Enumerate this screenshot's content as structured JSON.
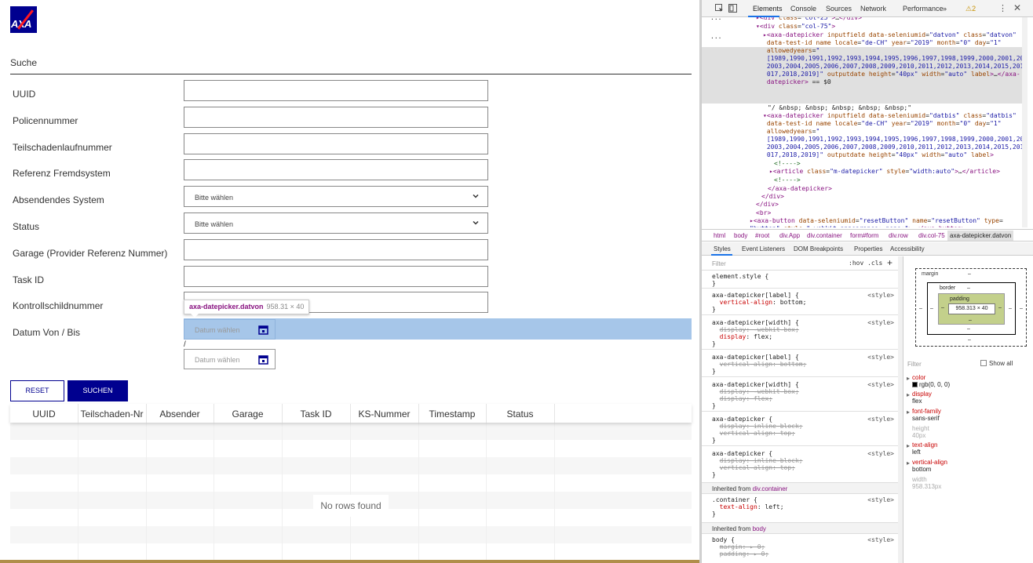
{
  "app": {
    "logo_text": "AXA",
    "section_title": "Suche",
    "fields": [
      {
        "label": "UUID",
        "type": "input",
        "value": ""
      },
      {
        "label": "Policennummer",
        "type": "input",
        "value": ""
      },
      {
        "label": "Teilschadenlaufnummer",
        "type": "input",
        "value": ""
      },
      {
        "label": "Referenz Fremdsystem",
        "type": "input",
        "value": ""
      },
      {
        "label": "Absendendes System",
        "type": "select",
        "value": "Bitte wählen"
      },
      {
        "label": "Status",
        "type": "select",
        "value": "Bitte wählen"
      },
      {
        "label": "Garage (Provider Referenz Nummer)",
        "type": "input",
        "value": ""
      },
      {
        "label": "Task ID",
        "type": "input",
        "value": ""
      },
      {
        "label": "Kontrollschildnummer",
        "type": "input",
        "value": ""
      },
      {
        "label": "Datum Von / Bis",
        "type": "daterange",
        "value": ""
      }
    ],
    "datepicker": {
      "placeholder_from": "Datum wählen",
      "separator": "/",
      "placeholder_to": "Datum wählen"
    },
    "tooltip": {
      "element": "axa-datepicker.datvon",
      "size": "958.31 × 40"
    },
    "buttons": {
      "reset": "RESET",
      "search": "SUCHEN"
    },
    "grid": {
      "columns": [
        "UUID",
        "Teilschaden-Nr",
        "Absender",
        "Garage",
        "Task ID",
        "KS-Nummer",
        "Timestamp",
        "Status"
      ],
      "empty_text": "No rows found"
    }
  },
  "devtools": {
    "tabs": [
      "Elements",
      "Console",
      "Sources",
      "Network",
      "Performance",
      "»"
    ],
    "warning_count": "2",
    "breadcrumbs": [
      "html",
      "body",
      "#root",
      "div.App",
      "div.container",
      "form#form",
      "div.row",
      "div.col-75",
      "axa-datepicker.datvon"
    ],
    "subtabs": [
      "Styles",
      "Event Listeners",
      "DOM Breakpoints",
      "Properties",
      "Accessibility"
    ],
    "styles_filter_placeholder": "Filter",
    "styles_hov": ":hov .cls",
    "box_model": {
      "margin": "margin",
      "border": "border",
      "padding": "padding",
      "content": "958.313 × 40",
      "dash": "–"
    },
    "computed_filter": "Filter",
    "computed_showall": "Show all",
    "computed": [
      {
        "prop": "color",
        "value": "rgb(0, 0, 0)",
        "swatch": "#000000",
        "faded": false
      },
      {
        "prop": "display",
        "value": "flex",
        "faded": false
      },
      {
        "prop": "font-family",
        "value": "sans-serif",
        "faded": false
      },
      {
        "prop": "height",
        "value": "40px",
        "faded": true
      },
      {
        "prop": "text-align",
        "value": "left",
        "faded": false
      },
      {
        "prop": "vertical-align",
        "value": "bottom",
        "faded": false
      },
      {
        "prop": "width",
        "value": "958.313px",
        "faded": true
      }
    ]
  }
}
